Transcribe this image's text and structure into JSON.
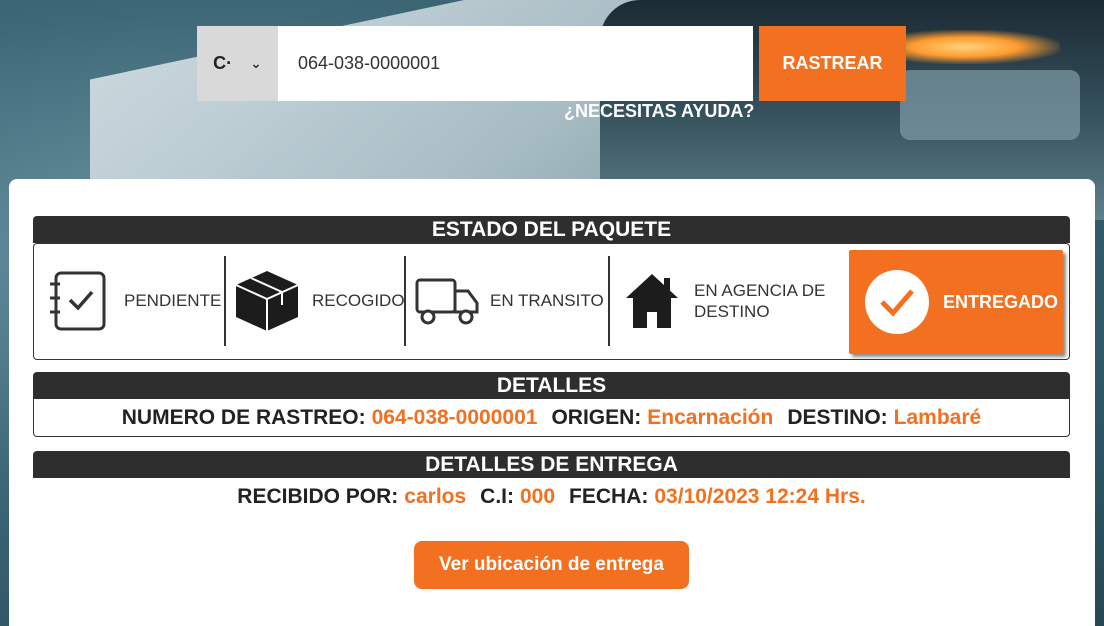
{
  "search": {
    "type_selected": "C·",
    "tracking_value": "064-038-0000001",
    "track_button": "RASTREAR",
    "help_link": "¿NECESITAS AYUDA?"
  },
  "status": {
    "header": "ESTADO DEL PAQUETE",
    "steps": [
      {
        "label": "PENDIENTE",
        "icon": "checklist-icon"
      },
      {
        "label": "RECOGIDO",
        "icon": "package-icon"
      },
      {
        "label": "EN TRANSITO",
        "icon": "truck-icon"
      },
      {
        "label_line1": "EN AGENCIA DE",
        "label_line2": "DESTINO",
        "icon": "house-icon"
      },
      {
        "label": "ENTREGADO",
        "icon": "check-circle-icon",
        "active": true
      }
    ]
  },
  "details": {
    "header": "DETALLES",
    "tracking_label": "NUMERO DE RASTREO:",
    "tracking_value": "064-038-0000001",
    "origin_label": "ORIGEN:",
    "origin_value": "Encarnación",
    "destination_label": "DESTINO:",
    "destination_value": "Lambaré"
  },
  "delivery": {
    "header": "DETALLES DE ENTREGA",
    "received_label": "RECIBIDO POR:",
    "received_value": "carlos",
    "ci_label": "C.I:",
    "ci_value": "000",
    "date_label": "FECHA:",
    "date_value": "03/10/2023 12:24 Hrs.",
    "location_button": "Ver ubicación de entrega"
  },
  "colors": {
    "accent": "#f37021",
    "dark_bar": "#2e2e2e"
  }
}
